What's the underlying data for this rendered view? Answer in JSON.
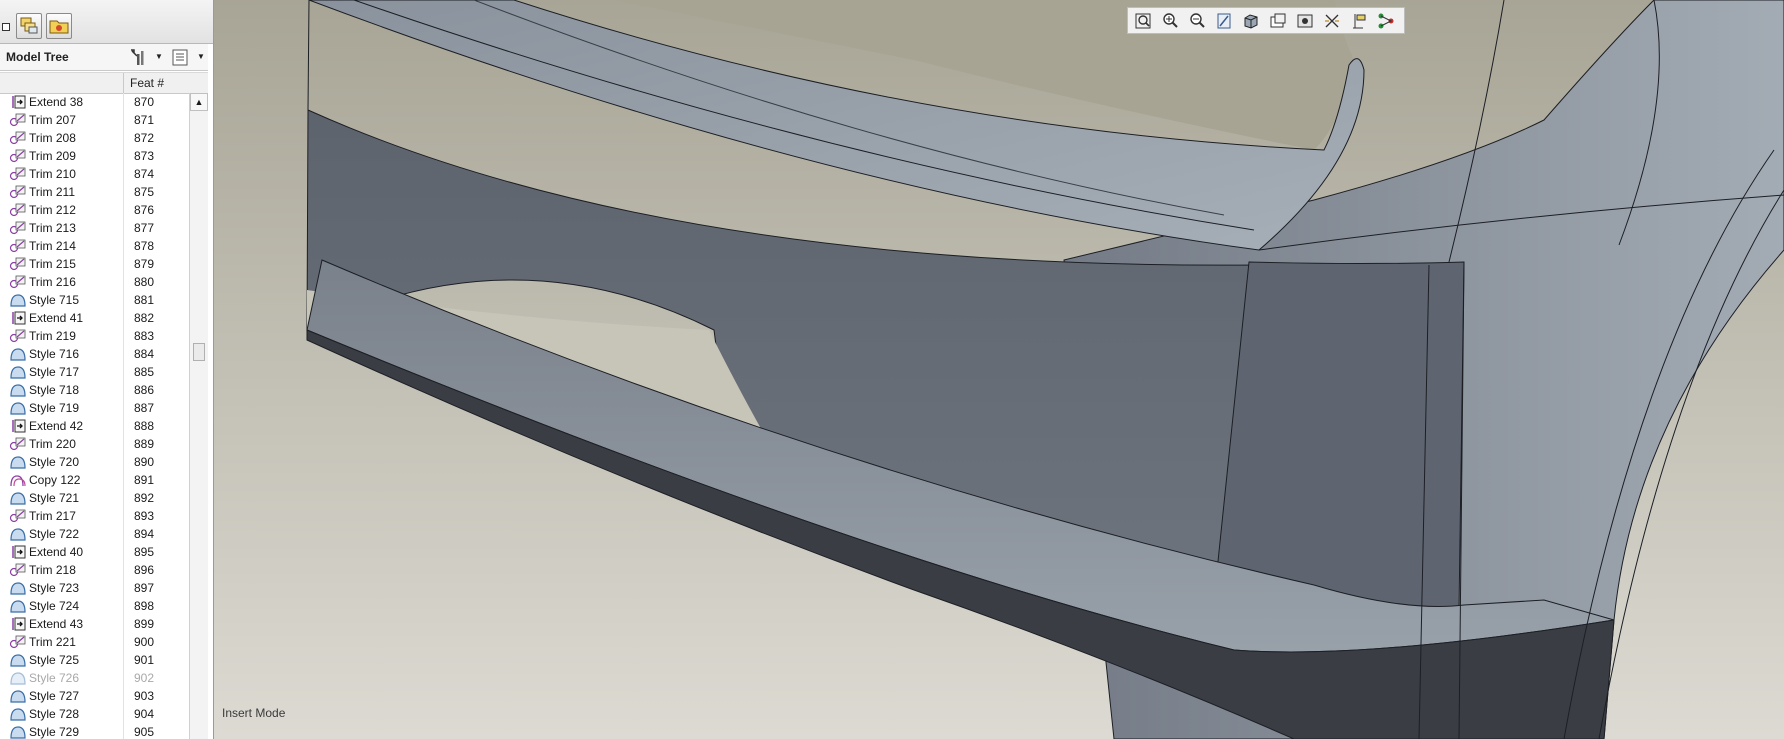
{
  "model_tree": {
    "title": "Model Tree",
    "column_feat": "Feat #",
    "rows": [
      {
        "name": "Extend 38",
        "num": "870",
        "icon": "extend-icon",
        "dim": false
      },
      {
        "name": "Trim 207",
        "num": "871",
        "icon": "trim-icon",
        "dim": false
      },
      {
        "name": "Trim 208",
        "num": "872",
        "icon": "trim-icon",
        "dim": false
      },
      {
        "name": "Trim 209",
        "num": "873",
        "icon": "trim-icon",
        "dim": false
      },
      {
        "name": "Trim 210",
        "num": "874",
        "icon": "trim-icon",
        "dim": false
      },
      {
        "name": "Trim 211",
        "num": "875",
        "icon": "trim-icon",
        "dim": false
      },
      {
        "name": "Trim 212",
        "num": "876",
        "icon": "trim-icon",
        "dim": false
      },
      {
        "name": "Trim 213",
        "num": "877",
        "icon": "trim-icon",
        "dim": false
      },
      {
        "name": "Trim 214",
        "num": "878",
        "icon": "trim-icon",
        "dim": false
      },
      {
        "name": "Trim 215",
        "num": "879",
        "icon": "trim-icon",
        "dim": false
      },
      {
        "name": "Trim 216",
        "num": "880",
        "icon": "trim-icon",
        "dim": false
      },
      {
        "name": "Style 715",
        "num": "881",
        "icon": "style-icon",
        "dim": false
      },
      {
        "name": "Extend 41",
        "num": "882",
        "icon": "extend-icon",
        "dim": false
      },
      {
        "name": "Trim 219",
        "num": "883",
        "icon": "trim-icon",
        "dim": false
      },
      {
        "name": "Style 716",
        "num": "884",
        "icon": "style-icon",
        "dim": false
      },
      {
        "name": "Style 717",
        "num": "885",
        "icon": "style-icon",
        "dim": false
      },
      {
        "name": "Style 718",
        "num": "886",
        "icon": "style-icon",
        "dim": false
      },
      {
        "name": "Style 719",
        "num": "887",
        "icon": "style-icon",
        "dim": false
      },
      {
        "name": "Extend 42",
        "num": "888",
        "icon": "extend-icon",
        "dim": false
      },
      {
        "name": "Trim 220",
        "num": "889",
        "icon": "trim-icon",
        "dim": false
      },
      {
        "name": "Style 720",
        "num": "890",
        "icon": "style-icon",
        "dim": false
      },
      {
        "name": "Copy 122",
        "num": "891",
        "icon": "copy-icon",
        "dim": false
      },
      {
        "name": "Style 721",
        "num": "892",
        "icon": "style-icon",
        "dim": false
      },
      {
        "name": "Trim 217",
        "num": "893",
        "icon": "trim-icon",
        "dim": false
      },
      {
        "name": "Style 722",
        "num": "894",
        "icon": "style-icon",
        "dim": false
      },
      {
        "name": "Extend 40",
        "num": "895",
        "icon": "extend-icon",
        "dim": false
      },
      {
        "name": "Trim 218",
        "num": "896",
        "icon": "trim-icon",
        "dim": false
      },
      {
        "name": "Style 723",
        "num": "897",
        "icon": "style-icon",
        "dim": false
      },
      {
        "name": "Style 724",
        "num": "898",
        "icon": "style-icon",
        "dim": false
      },
      {
        "name": "Extend 43",
        "num": "899",
        "icon": "extend-icon",
        "dim": false
      },
      {
        "name": "Trim 221",
        "num": "900",
        "icon": "trim-icon",
        "dim": false
      },
      {
        "name": "Style 725",
        "num": "901",
        "icon": "style-icon",
        "dim": false
      },
      {
        "name": "Style 726",
        "num": "902",
        "icon": "style-icon",
        "dim": true
      },
      {
        "name": "Style 727",
        "num": "903",
        "icon": "style-icon",
        "dim": false
      },
      {
        "name": "Style 728",
        "num": "904",
        "icon": "style-icon",
        "dim": false
      },
      {
        "name": "Style 729",
        "num": "905",
        "icon": "style-icon",
        "dim": false
      }
    ]
  },
  "header_icons": [
    "settings-tools-icon",
    "tree-display-icon"
  ],
  "tab_icons": [
    "layers-icon",
    "folder-star-icon"
  ],
  "view_toolbar": {
    "buttons": [
      "zoom-fit-icon",
      "zoom-in-icon",
      "zoom-out-icon",
      "repaint-icon",
      "display-style-icon",
      "saved-views-icon",
      "view-manager-icon",
      "datum-display-icon",
      "annotation-display-icon",
      "spin-center-icon"
    ]
  },
  "status": {
    "mode": "Insert Mode"
  },
  "colors": {
    "background_top": "#a8a596",
    "background_bottom": "#dcdad2",
    "body_surface": "#6b717c",
    "edge_line": "#1c1f24",
    "trim_icon": "#8a3fa8",
    "style_icon": "#3a6ea8"
  }
}
